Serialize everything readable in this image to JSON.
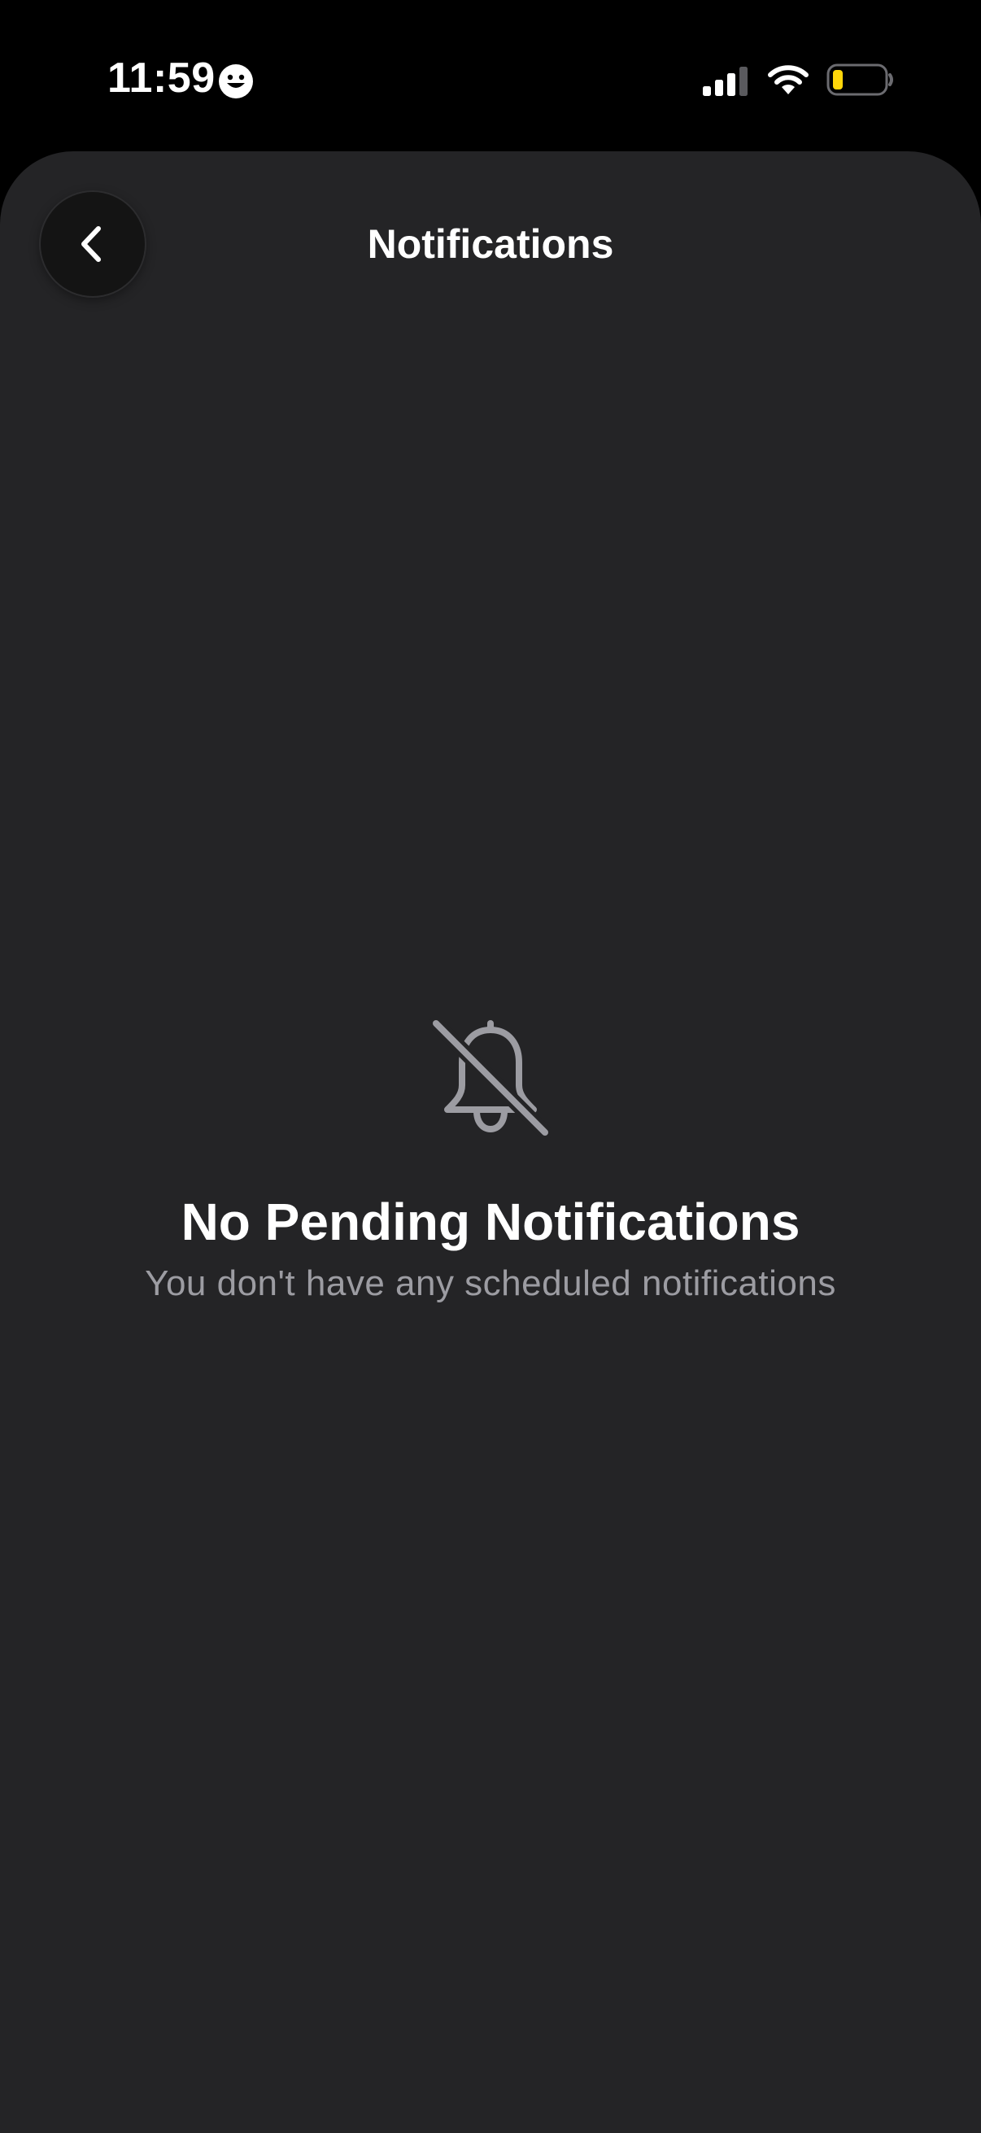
{
  "status_bar": {
    "time": "11:59",
    "emoji_icon": "smiley-face-icon",
    "signal_icon": "cellular-signal-icon",
    "wifi_icon": "wifi-icon",
    "battery_icon": "battery-low-icon",
    "battery_level": 0.15,
    "battery_color": "#ffd60a"
  },
  "header": {
    "back_icon": "chevron-left-icon",
    "title": "Notifications"
  },
  "empty_state": {
    "icon": "bell-slash-icon",
    "title": "No Pending Notifications",
    "subtitle": "You don't have any scheduled notifications"
  },
  "colors": {
    "background": "#242426",
    "status_bar_bg": "#000000",
    "back_button_bg": "#141414",
    "title_text": "#ffffff",
    "subtitle_text": "#9c9ca2",
    "icon_gray": "#9c9ca2"
  }
}
